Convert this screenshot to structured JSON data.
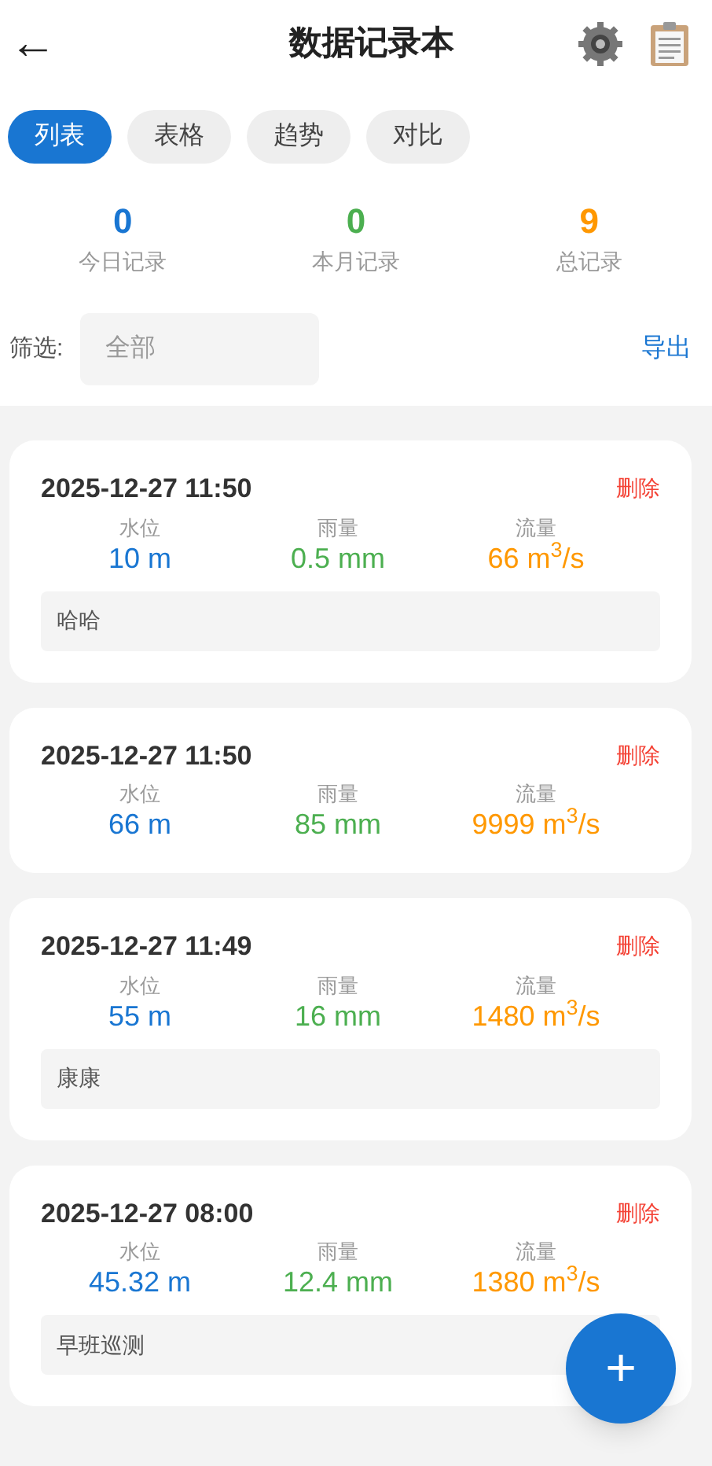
{
  "header": {
    "back": "←",
    "title": "数据记录本"
  },
  "tabs": [
    {
      "label": "列表",
      "selected": true
    },
    {
      "label": "表格",
      "selected": false
    },
    {
      "label": "趋势",
      "selected": false
    },
    {
      "label": "对比",
      "selected": false
    }
  ],
  "stats": [
    {
      "value": "0",
      "label": "今日记录",
      "color": "#1976d2"
    },
    {
      "value": "0",
      "label": "本月记录",
      "color": "#4caf50"
    },
    {
      "value": "9",
      "label": "总记录",
      "color": "#ff9800"
    }
  ],
  "filter": {
    "label": "筛选:",
    "value": "全部",
    "export": "导出"
  },
  "records": [
    {
      "time": "2025-12-27 11:50",
      "delete": "删除",
      "metrics": [
        {
          "kind": "level",
          "label": "水位",
          "value": "10 m"
        },
        {
          "kind": "rain",
          "label": "雨量",
          "value": "0.5 mm"
        },
        {
          "kind": "flow",
          "label": "流量",
          "value": "66 m$^{3}$/s"
        }
      ],
      "note": "哈哈"
    },
    {
      "time": "2025-12-27 11:50",
      "delete": "删除",
      "metrics": [
        {
          "kind": "level",
          "label": "水位",
          "value": "66 m"
        },
        {
          "kind": "rain",
          "label": "雨量",
          "value": "85 mm"
        },
        {
          "kind": "flow",
          "label": "流量",
          "value": "9999 m$^{3}$/s"
        }
      ]
    },
    {
      "time": "2025-12-27 11:49",
      "delete": "删除",
      "metrics": [
        {
          "kind": "level",
          "label": "水位",
          "value": "55 m"
        },
        {
          "kind": "rain",
          "label": "雨量",
          "value": "16 mm"
        },
        {
          "kind": "flow",
          "label": "流量",
          "value": "1480 m$^{3}$/s"
        }
      ],
      "note": "康康"
    },
    {
      "time": "2025-12-27 08:00",
      "delete": "删除",
      "metrics": [
        {
          "kind": "level",
          "label": "水位",
          "value": "45.32 m"
        },
        {
          "kind": "rain",
          "label": "雨量",
          "value": "12.4 mm"
        },
        {
          "kind": "flow",
          "label": "流量",
          "value": "1380 m$^{3}$/s"
        }
      ],
      "note": "早班巡测"
    }
  ],
  "fab": "+"
}
